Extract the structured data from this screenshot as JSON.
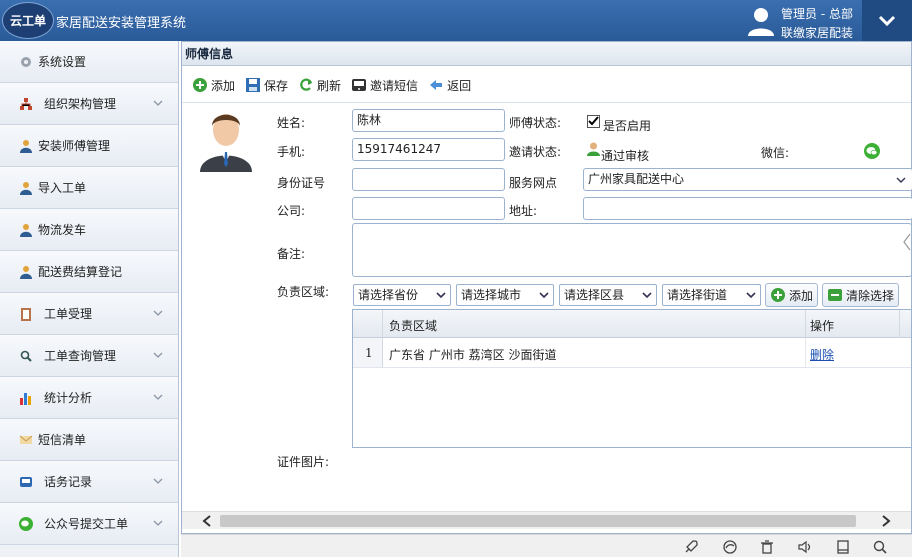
{
  "header": {
    "logo_text": "云工单",
    "title": "家居配送安装管理系统",
    "user_role": "管理员 - 总部",
    "user_org": "联缴家居配装"
  },
  "sidebar": {
    "items": [
      {
        "label": "系统设置",
        "icon": "gear-icon",
        "expandable": false
      },
      {
        "label": "组织架构管理",
        "icon": "org-chart-icon",
        "expandable": true
      },
      {
        "label": "安装师傅管理",
        "icon": "worker-icon",
        "expandable": false
      },
      {
        "label": "导入工单",
        "icon": "worker-icon",
        "expandable": false
      },
      {
        "label": "物流发车",
        "icon": "worker-icon",
        "expandable": false
      },
      {
        "label": "配送费结算登记",
        "icon": "worker-icon",
        "expandable": false
      },
      {
        "label": "工单受理",
        "icon": "clipboard-icon",
        "expandable": true
      },
      {
        "label": "工单查询管理",
        "icon": "search-icon",
        "expandable": true
      },
      {
        "label": "统计分析",
        "icon": "bar-chart-icon",
        "expandable": true
      },
      {
        "label": "短信清单",
        "icon": "envelope-icon",
        "expandable": false
      },
      {
        "label": "话务记录",
        "icon": "phone-icon",
        "expandable": true
      },
      {
        "label": "公众号提交工单",
        "icon": "wechat-icon",
        "expandable": true
      }
    ]
  },
  "panel": {
    "title": "师傅信息"
  },
  "toolbar": {
    "add": "添加",
    "save": "保存",
    "refresh": "刷新",
    "invite_sms": "邀请短信",
    "back": "返回"
  },
  "form": {
    "name_label": "姓名:",
    "name_value": "陈林",
    "status_label": "师傅状态:",
    "enabled_label": "是否启用",
    "enabled_checked": true,
    "phone_label": "手机:",
    "phone_value": "15917461247",
    "invite_label": "邀请状态:",
    "invite_value": "通过审核",
    "wechat_label": "微信:",
    "idcard_label": "身份证号",
    "idcard_value": "",
    "branch_label": "服务网点",
    "branch_value": "广州家具配送中心",
    "company_label": "公司:",
    "company_value": "",
    "address_label": "地址:",
    "address_value": "",
    "remark_label": "备注:",
    "region_label": "负责区域:",
    "province_placeholder": "请选择省份",
    "city_placeholder": "请选择城市",
    "district_placeholder": "请选择区县",
    "street_placeholder": "请选择街道",
    "region_add": "添加",
    "region_clear": "清除选择",
    "cert_label": "证件图片:"
  },
  "region_table": {
    "columns": [
      "负责区域",
      "操作"
    ],
    "rows": [
      {
        "index": "1",
        "region": "广东省 广州市 荔湾区 沙面街道",
        "action": "删除"
      }
    ]
  }
}
